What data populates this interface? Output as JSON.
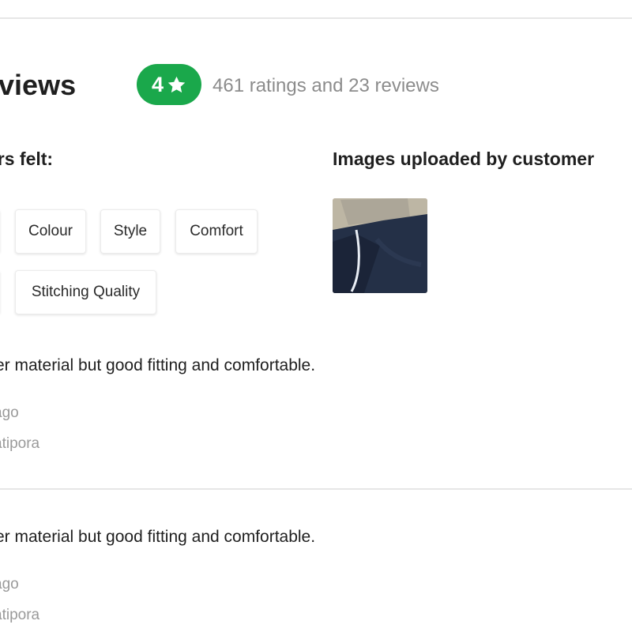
{
  "ratings": {
    "heading": "eviews",
    "score": "4",
    "summary": "461 ratings and 23 reviews",
    "badge_color": "#1aa84b",
    "star_icon": "star-icon"
  },
  "felt": {
    "title": "ers felt:",
    "chips": [
      "Colour",
      "Style",
      "Comfort",
      "Stitching Quality"
    ]
  },
  "customer_images": {
    "title": "Images uploaded by customer"
  },
  "reviews": [
    {
      "text": "er material but good fitting and comfortable.",
      "time": "ago",
      "location": "atipora"
    },
    {
      "text": "er material but good fitting and comfortable.",
      "time": "ago",
      "location": "atipora"
    }
  ]
}
